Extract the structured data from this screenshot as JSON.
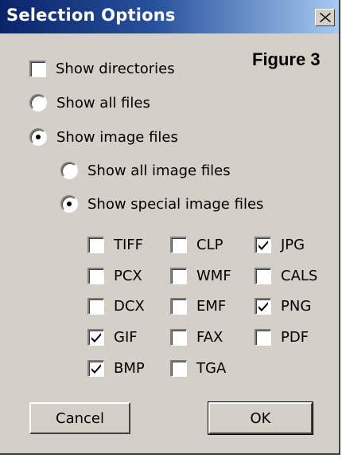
{
  "dialog": {
    "title": "Selection Options",
    "figure_label": "Figure 3"
  },
  "options": {
    "show_directories": {
      "label": "Show directories",
      "checked": false
    },
    "show_all_files": {
      "label": "Show all files",
      "selected": false
    },
    "show_image_files": {
      "label": "Show image files",
      "selected": true
    },
    "show_all_image_files": {
      "label": "Show all image files",
      "selected": false
    },
    "show_special_image_files": {
      "label": "Show special image files",
      "selected": true
    }
  },
  "formats": [
    {
      "label": "TIFF",
      "checked": false
    },
    {
      "label": "CLP",
      "checked": false
    },
    {
      "label": "JPG",
      "checked": true
    },
    {
      "label": "PCX",
      "checked": false
    },
    {
      "label": "WMF",
      "checked": false
    },
    {
      "label": "CALS",
      "checked": false
    },
    {
      "label": "DCX",
      "checked": false
    },
    {
      "label": "EMF",
      "checked": false
    },
    {
      "label": "PNG",
      "checked": true
    },
    {
      "label": "GIF",
      "checked": true
    },
    {
      "label": "FAX",
      "checked": false
    },
    {
      "label": "PDF",
      "checked": false
    },
    {
      "label": "BMP",
      "checked": true
    },
    {
      "label": "TGA",
      "checked": false
    }
  ],
  "buttons": {
    "cancel": "Cancel",
    "ok": "OK"
  },
  "icons": {
    "close": "close-icon",
    "check": "checkmark-icon"
  }
}
